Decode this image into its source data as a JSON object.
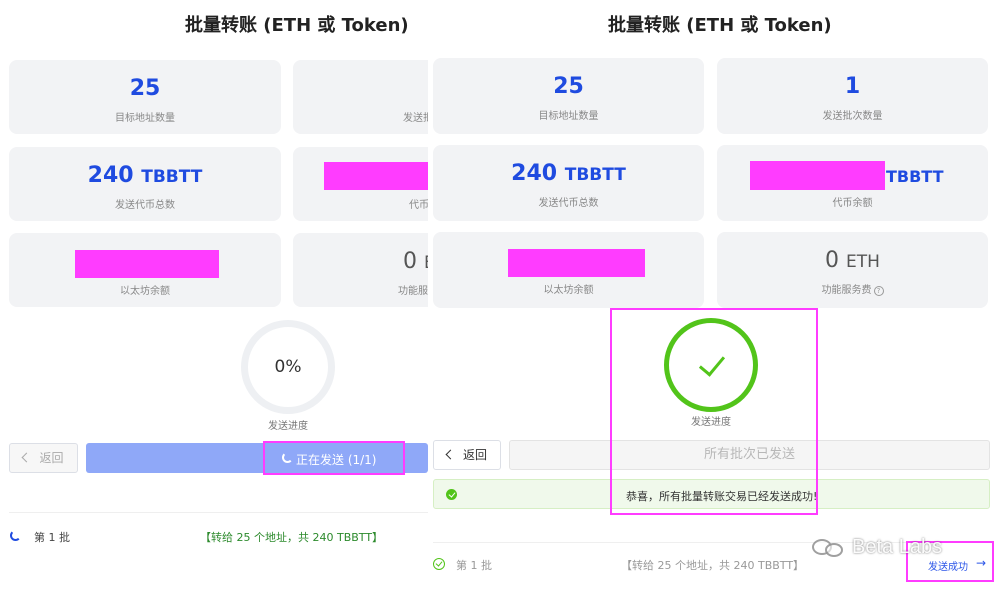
{
  "title": "批量转账 (ETH 或 Token)",
  "stats": {
    "target_count_value": "25",
    "target_count_label": "目标地址数量",
    "batch_count_value": "1",
    "batch_count_label": "发送批次数量",
    "total_amount_value": "240",
    "total_amount_unit": "TBBTT",
    "total_amount_label": "发送代币总数",
    "token_balance_unit": "TBBTT",
    "token_balance_label": "代币余额",
    "eth_balance_label": "以太坊余额",
    "fee_value": "0",
    "fee_unit": "ETH",
    "fee_label": "功能服务费",
    "help_glyph": "?"
  },
  "left": {
    "truncated_batch_label": "发送批",
    "truncated_token_label": "代币",
    "truncated_fee_unit": "E",
    "truncated_fee_label": "功能服",
    "progress_value": "0%",
    "progress_label": "发送进度",
    "back_label": "返回",
    "send_label": "正在发送 (1/1)",
    "batch_name": "第 1 批",
    "batch_info": "【转给 25 个地址，共 240 TBBTT】"
  },
  "right": {
    "progress_label": "发送进度",
    "back_label": "返回",
    "done_label": "所有批次已发送",
    "success_message": "恭喜，所有批量转账交易已经发送成功!",
    "batch_name": "第 1 批",
    "batch_info": "【转给 25 个地址，共 240 TBBTT】",
    "sent_link": "发送成功",
    "arrow_glyph": "→"
  },
  "watermark": {
    "text": "Beta Labs"
  },
  "colors": {
    "accent": "#1f4be0",
    "success": "#52c41a",
    "highlight": "#ff3cff",
    "send_button": "#8fa8f8"
  }
}
